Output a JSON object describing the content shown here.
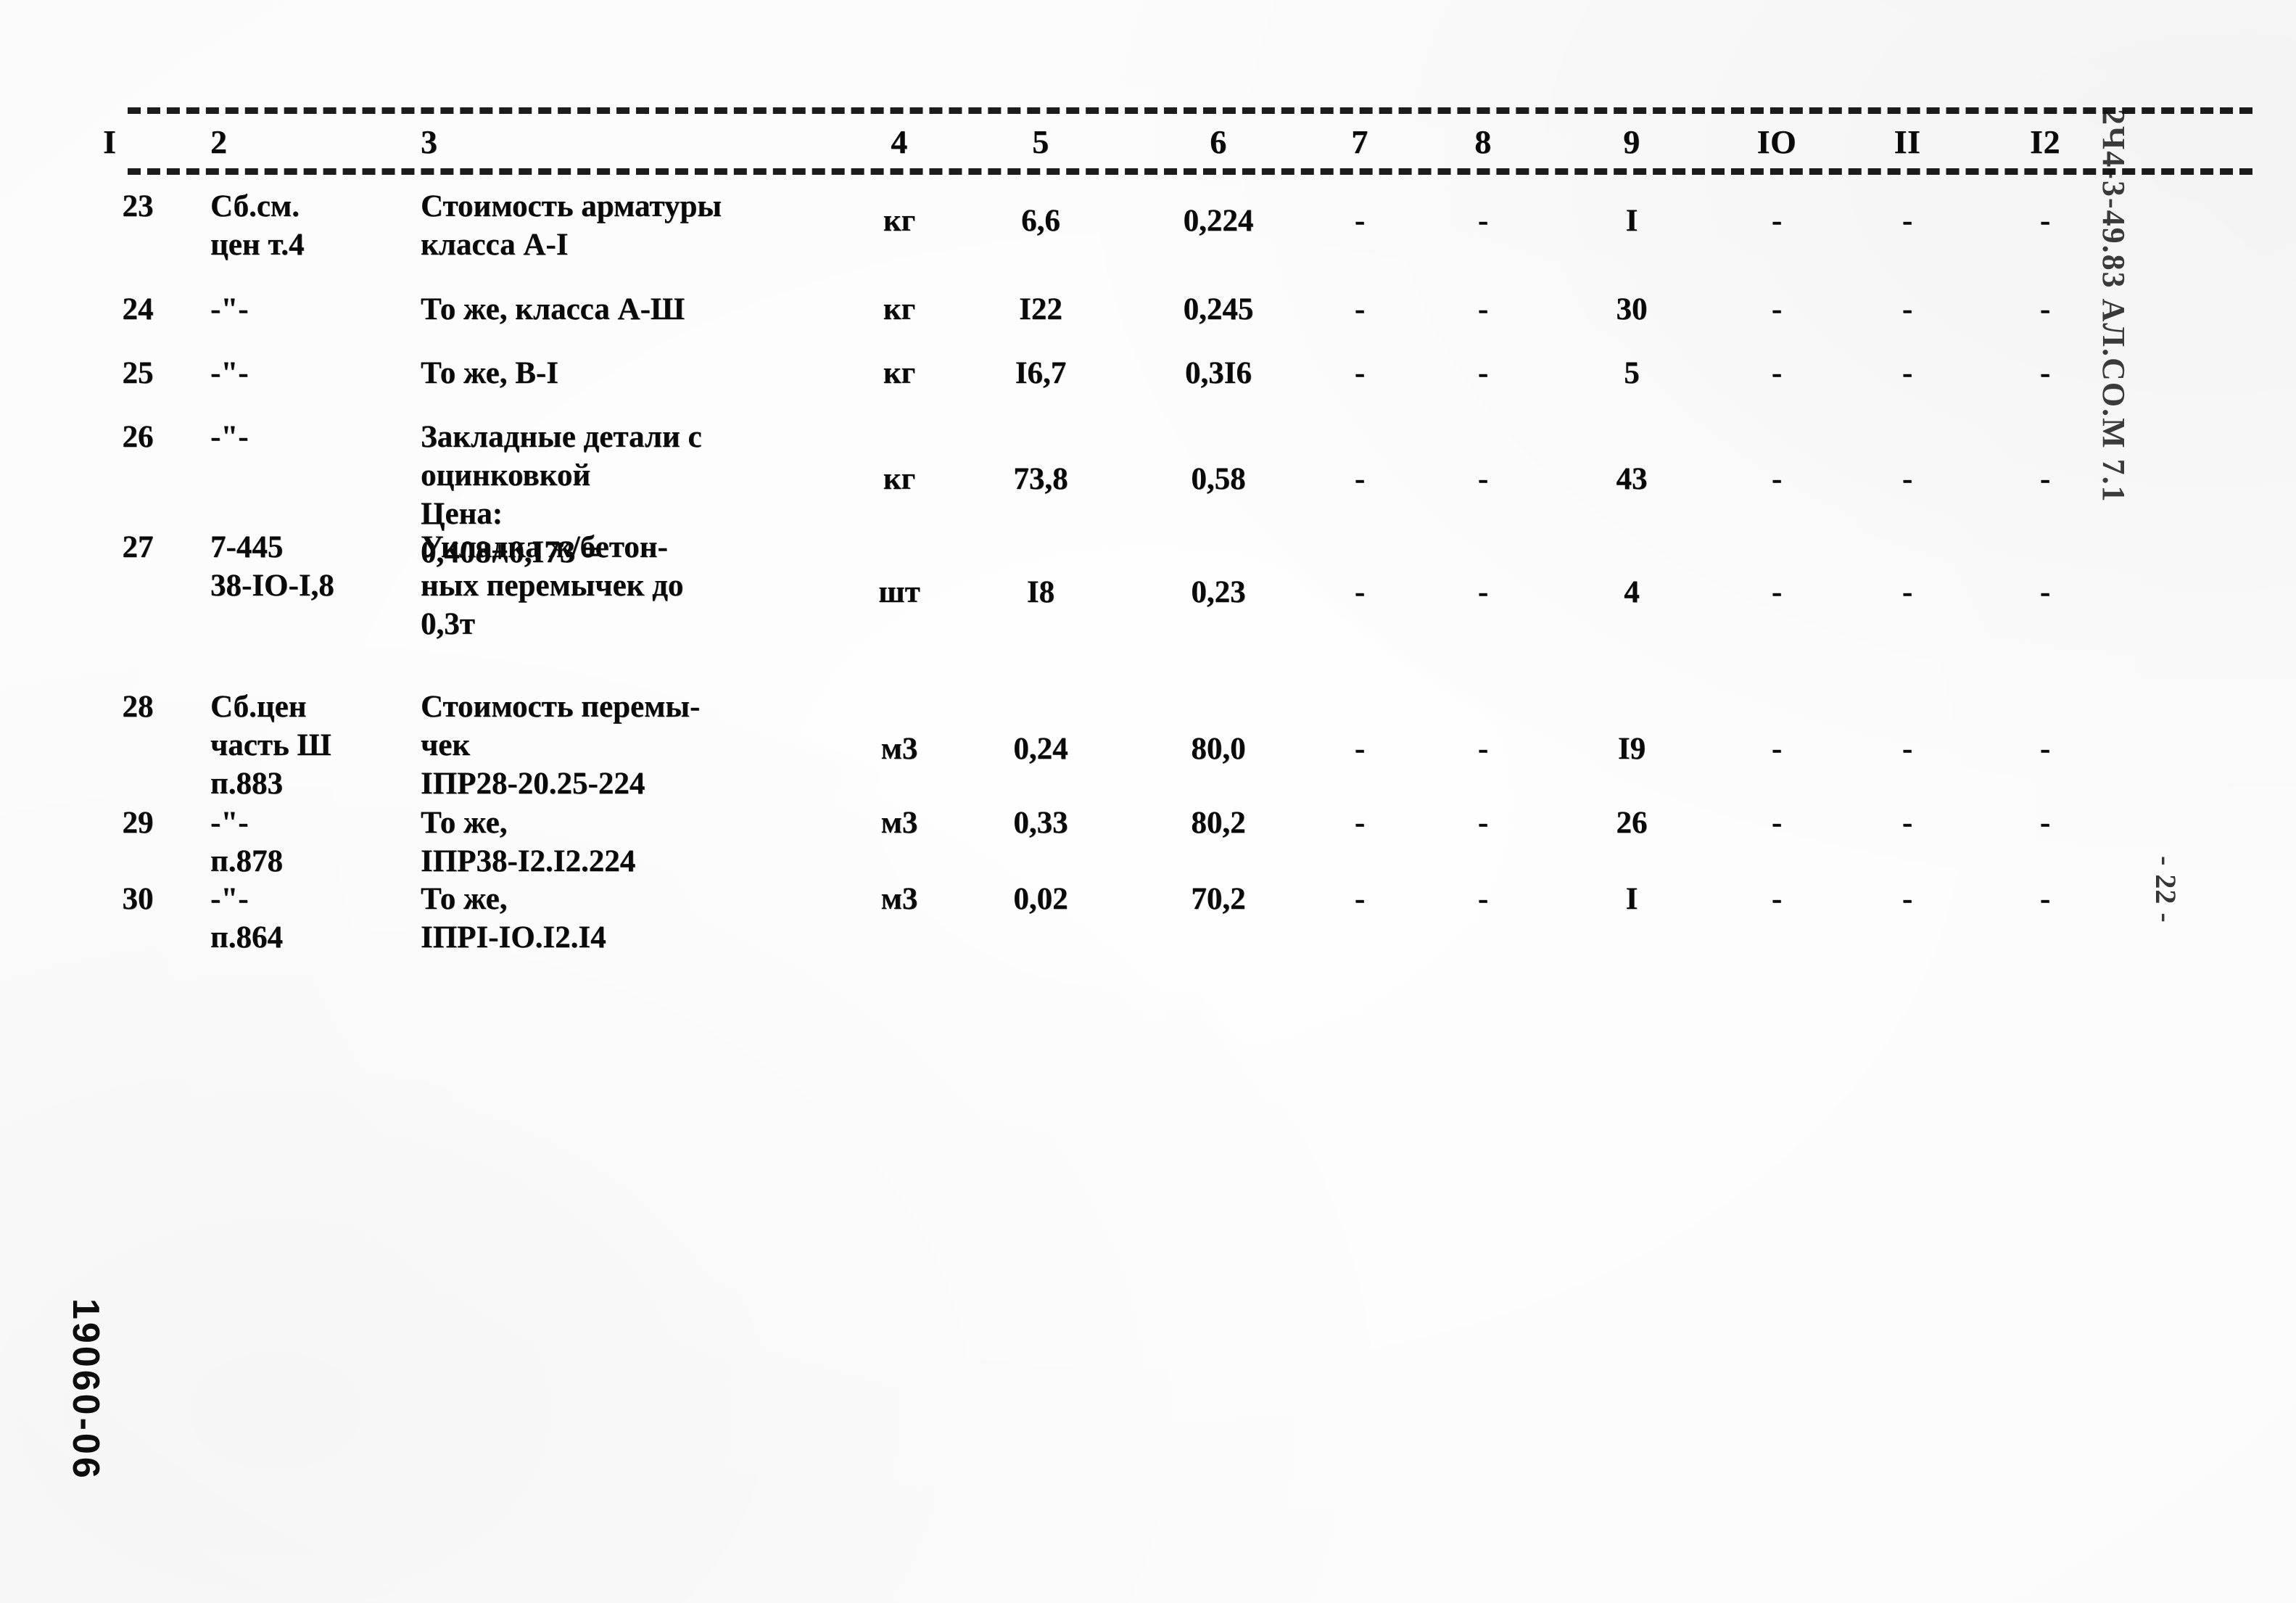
{
  "document": {
    "type": "scanned-estimate-table",
    "side_stamp_right": "2Ч4-3-49.83 АЛ.СО.М 7.1",
    "page_marker_right": "- 22 -",
    "archive_code_bottom_left": "19060-06"
  },
  "table": {
    "column_headers": [
      "I",
      "2",
      "3",
      "4",
      "5",
      "6",
      "7",
      "8",
      "9",
      "IO",
      "II",
      "I2"
    ],
    "rows": [
      {
        "c1": "23",
        "c2": "Сб.см.\nцен т.4",
        "c3": "Стоимость арматуры\nкласса А-I",
        "c4": "кг",
        "c5": "6,6",
        "c6": "0,224",
        "c7": "-",
        "c8": "-",
        "c9": "I",
        "c10": "-",
        "c11": "-",
        "c12": "-"
      },
      {
        "c1": "24",
        "c2": "-\"-",
        "c3": "То же, класса А-Ш",
        "c4": "кг",
        "c5": "I22",
        "c6": "0,245",
        "c7": "-",
        "c8": "-",
        "c9": "30",
        "c10": "-",
        "c11": "-",
        "c12": "-"
      },
      {
        "c1": "25",
        "c2": "-\"-",
        "c3": "То же, В-I",
        "c4": "кг",
        "c5": "I6,7",
        "c6": "0,3I6",
        "c7": "-",
        "c8": "-",
        "c9": "5",
        "c10": "-",
        "c11": "-",
        "c12": "-"
      },
      {
        "c1": "26",
        "c2": "-\"-",
        "c3": "Закладные детали с\nоцинковкой\nЦена:\n0,408+0,I73 =",
        "c4": "кг",
        "c5": "73,8",
        "c6": "0,58",
        "c7": "-",
        "c8": "-",
        "c9": "43",
        "c10": "-",
        "c11": "-",
        "c12": "-"
      },
      {
        "c1": "27",
        "c2": "7-445\n38-IO-I,8",
        "c3": "Укладка ж/бетон-\nных перемычек до\n0,3т",
        "c4": "шт",
        "c5": "I8",
        "c6": "0,23",
        "c7": "-",
        "c8": "-",
        "c9": "4",
        "c10": "-",
        "c11": "-",
        "c12": "-"
      },
      {
        "c1": "28",
        "c2": "Сб.цен\nчасть Ш\nп.883",
        "c3": "Стоимость перемы-\nчек\nIПР28-20.25-224",
        "c4": "м3",
        "c5": "0,24",
        "c6": "80,0",
        "c7": "-",
        "c8": "-",
        "c9": "I9",
        "c10": "-",
        "c11": "-",
        "c12": "-"
      },
      {
        "c1": "29",
        "c2": "-\"-\nп.878",
        "c3": "То же,\nIПР38-I2.I2.224",
        "c4": "м3",
        "c5": "0,33",
        "c6": "80,2",
        "c7": "-",
        "c8": "-",
        "c9": "26",
        "c10": "-",
        "c11": "-",
        "c12": "-"
      },
      {
        "c1": "30",
        "c2": "-\"-\nп.864",
        "c3": "То же,\nIПРI-IO.I2.I4",
        "c4": "м3",
        "c5": "0,02",
        "c6": "70,2",
        "c7": "-",
        "c8": "-",
        "c9": "I",
        "c10": "-",
        "c11": "-",
        "c12": "-"
      }
    ]
  }
}
